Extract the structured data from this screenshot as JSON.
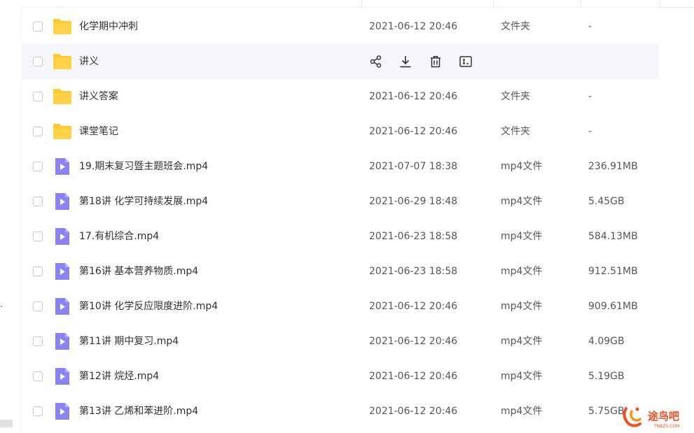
{
  "rows": [
    {
      "name": "化学期中冲刺",
      "time": "2021-06-12 20:46",
      "type": "文件夹",
      "size": "-",
      "kind": "folder"
    },
    {
      "name": "讲义",
      "time": "",
      "type": "",
      "size": "",
      "kind": "folder"
    },
    {
      "name": "讲义答案",
      "time": "2021-06-12 20:46",
      "type": "文件夹",
      "size": "-",
      "kind": "folder"
    },
    {
      "name": "课堂笔记",
      "time": "2021-06-12 20:46",
      "type": "文件夹",
      "size": "-",
      "kind": "folder"
    },
    {
      "name": "19.期末复习暨主题班会.mp4",
      "time": "2021-07-07 18:38",
      "type": "mp4文件",
      "size": "236.91MB",
      "kind": "video"
    },
    {
      "name": "第18讲 化学可持续发展.mp4",
      "time": "2021-06-29 18:48",
      "type": "mp4文件",
      "size": "5.45GB",
      "kind": "video"
    },
    {
      "name": "17.有机综合.mp4",
      "time": "2021-06-23 18:58",
      "type": "mp4文件",
      "size": "584.13MB",
      "kind": "video"
    },
    {
      "name": "第16讲 基本营养物质.mp4",
      "time": "2021-06-23 18:58",
      "type": "mp4文件",
      "size": "912.51MB",
      "kind": "video"
    },
    {
      "name": "第10讲 化学反应限度进阶.mp4",
      "time": "2021-06-12 20:46",
      "type": "mp4文件",
      "size": "909.61MB",
      "kind": "video"
    },
    {
      "name": "第11讲 期中复习.mp4",
      "time": "2021-06-12 20:46",
      "type": "mp4文件",
      "size": "4.09GB",
      "kind": "video"
    },
    {
      "name": "第12讲 烷烃.mp4",
      "time": "2021-06-12 20:46",
      "type": "mp4文件",
      "size": "5.19GB",
      "kind": "video"
    },
    {
      "name": "第13讲 乙烯和苯进阶.mp4",
      "time": "2021-06-12 20:46",
      "type": "mp4文件",
      "size": "5.75GB",
      "kind": "video"
    }
  ],
  "hover_actions": [
    "share-icon",
    "download-icon",
    "delete-icon",
    "rename-icon"
  ],
  "watermark": {
    "brand": "途鸟吧",
    "domain": "TNBZS.COM"
  },
  "colors": {
    "folder": "#ffc933",
    "video": "#8c83f2",
    "hover_row": "#f5f6f9",
    "text": "#2f3035",
    "subtext": "#54565c"
  }
}
